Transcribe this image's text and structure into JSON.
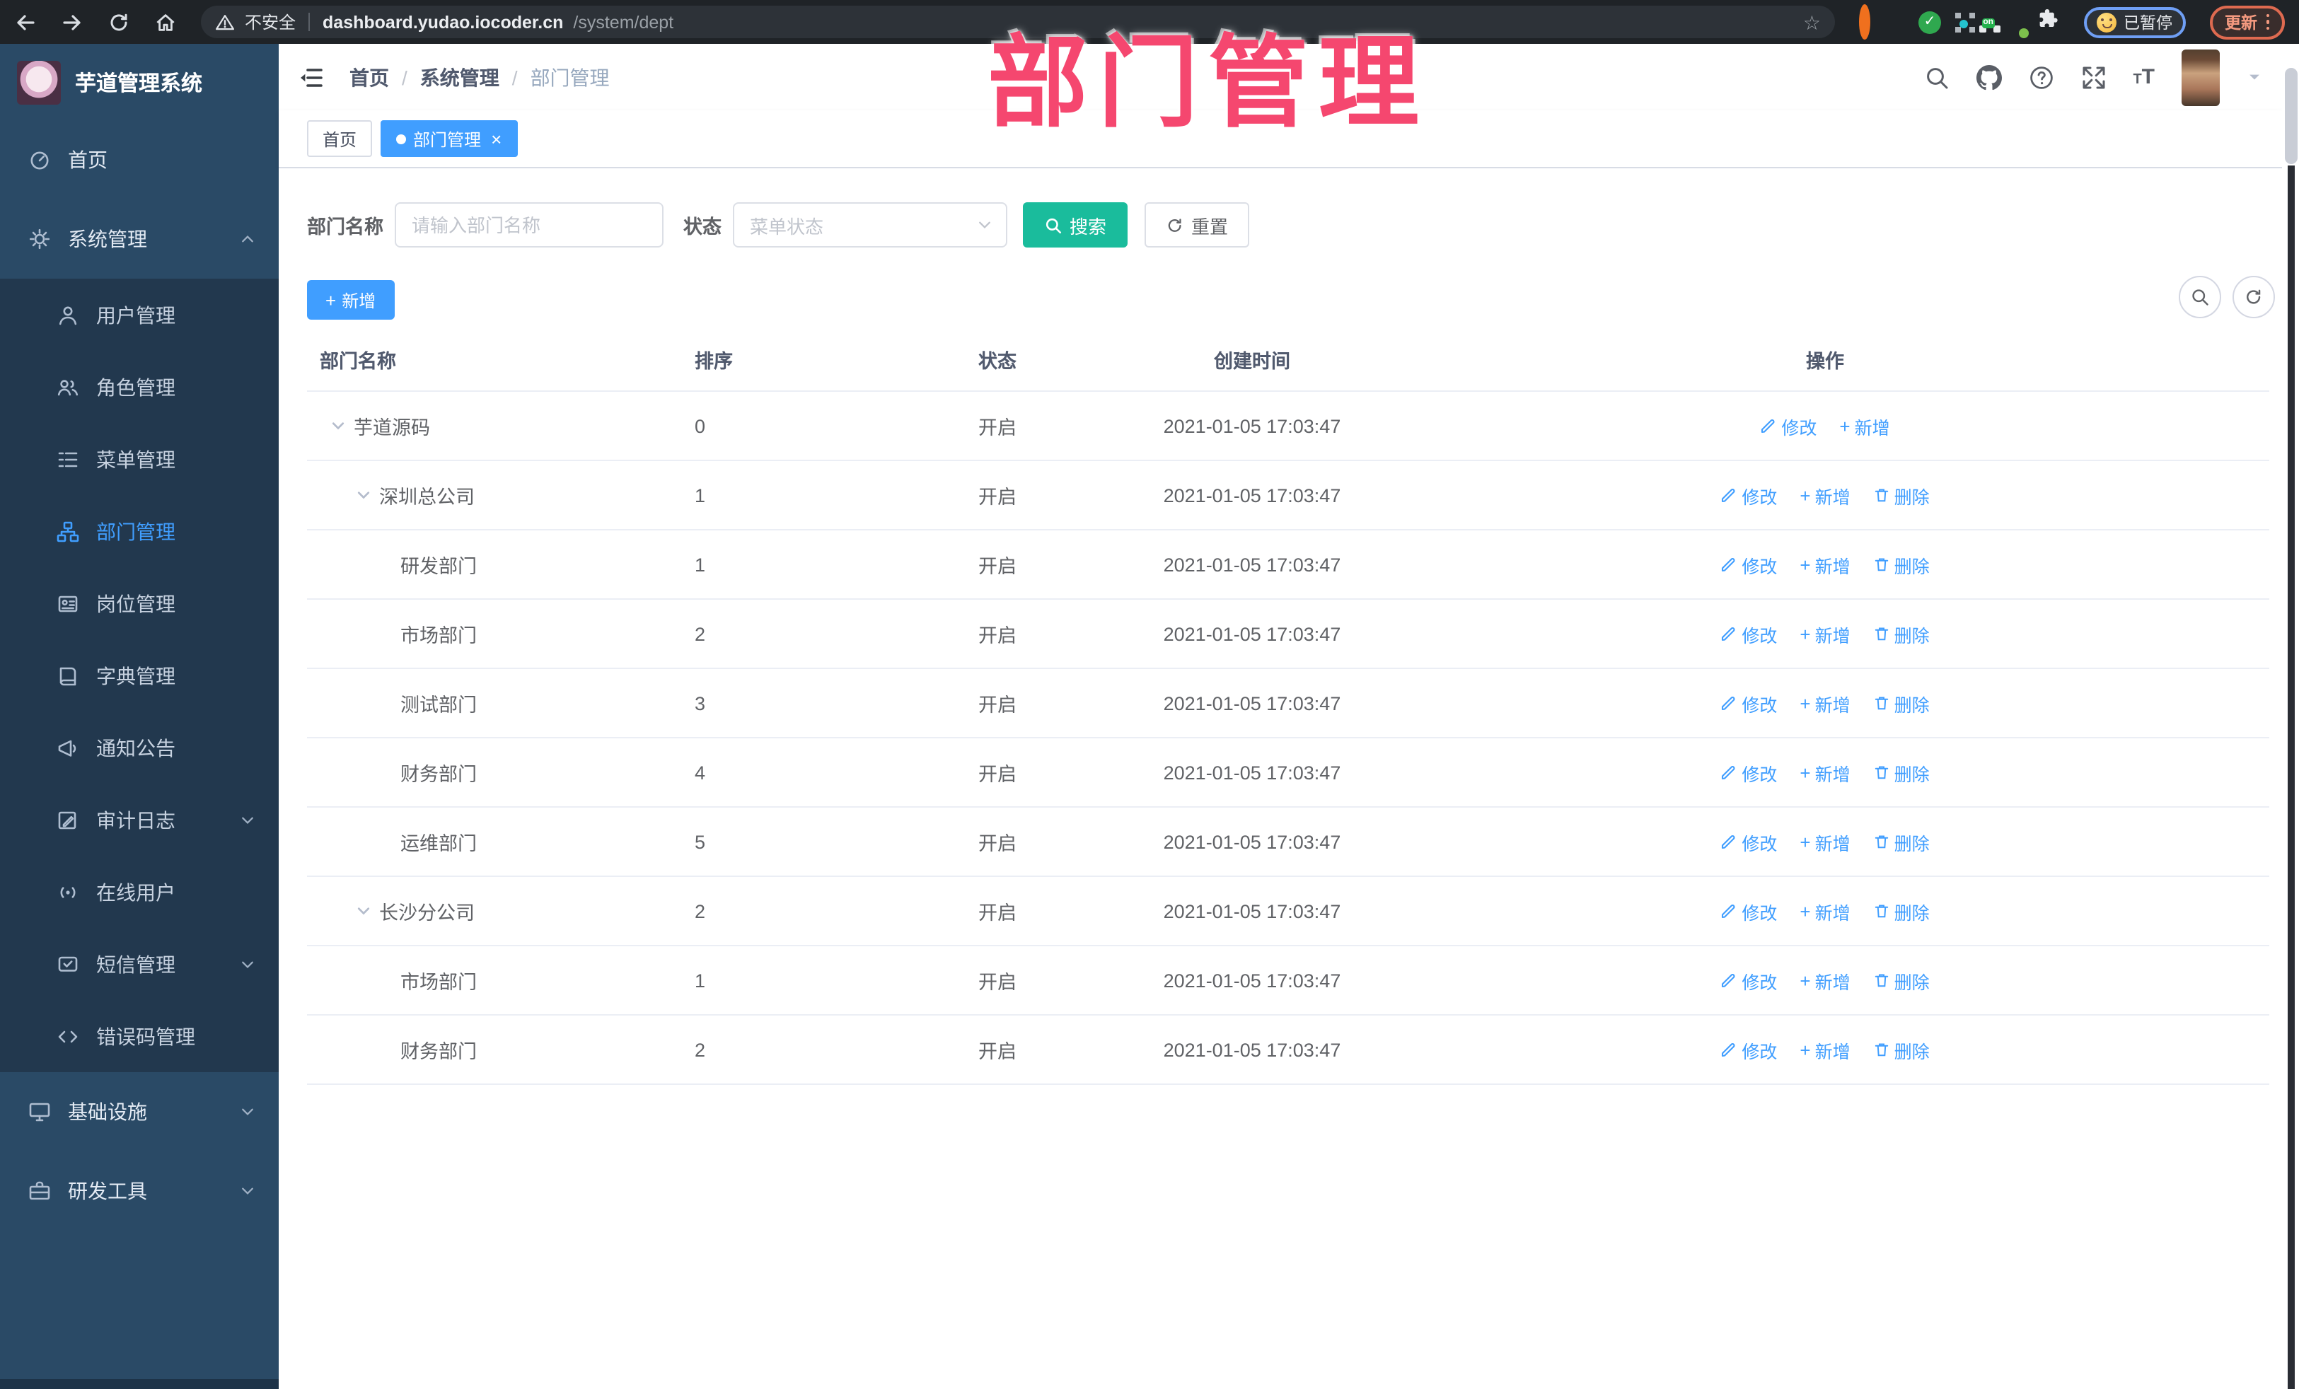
{
  "annotation": {
    "text": "部门管理",
    "color": "#F5476F"
  },
  "browser": {
    "security_label": "不安全",
    "url_host": "dashboard.yudao.iocoder.cn",
    "url_path": "/system/dept",
    "profile_status": "已暂停",
    "update_label": "更新"
  },
  "glyphs": {
    "slash": "/",
    "close": "×",
    "plus": "+",
    "star": "☆",
    "check": "✓"
  },
  "sidebar": {
    "logo_title": "芋道管理系统",
    "items": [
      {
        "label": "首页"
      },
      {
        "label": "系统管理"
      },
      {
        "label": "用户管理"
      },
      {
        "label": "角色管理"
      },
      {
        "label": "菜单管理"
      },
      {
        "label": "部门管理"
      },
      {
        "label": "岗位管理"
      },
      {
        "label": "字典管理"
      },
      {
        "label": "通知公告"
      },
      {
        "label": "审计日志"
      },
      {
        "label": "在线用户"
      },
      {
        "label": "短信管理"
      },
      {
        "label": "错误码管理"
      },
      {
        "label": "基础设施"
      },
      {
        "label": "研发工具"
      }
    ]
  },
  "app_header": {
    "breadcrumb": [
      "首页",
      "系统管理",
      "部门管理"
    ]
  },
  "tabs": [
    {
      "label": "首页"
    },
    {
      "label": "部门管理"
    }
  ],
  "filters": {
    "dept_label": "部门名称",
    "dept_placeholder": "请输入部门名称",
    "status_label": "状态",
    "status_placeholder": "菜单状态",
    "search_label": "搜索",
    "reset_label": "重置"
  },
  "toolbar": {
    "add_label": "新增"
  },
  "table": {
    "columns": [
      "部门名称",
      "排序",
      "状态",
      "创建时间",
      "操作"
    ],
    "action_labels": {
      "edit": "修改",
      "add": "新增",
      "delete": "删除"
    },
    "rows": [
      {
        "name": "芋道源码",
        "sort": "0",
        "status": "开启",
        "time": "2021-01-05 17:03:47"
      },
      {
        "name": "深圳总公司",
        "sort": "1",
        "status": "开启",
        "time": "2021-01-05 17:03:47"
      },
      {
        "name": "研发部门",
        "sort": "1",
        "status": "开启",
        "time": "2021-01-05 17:03:47"
      },
      {
        "name": "市场部门",
        "sort": "2",
        "status": "开启",
        "time": "2021-01-05 17:03:47"
      },
      {
        "name": "测试部门",
        "sort": "3",
        "status": "开启",
        "time": "2021-01-05 17:03:47"
      },
      {
        "name": "财务部门",
        "sort": "4",
        "status": "开启",
        "time": "2021-01-05 17:03:47"
      },
      {
        "name": "运维部门",
        "sort": "5",
        "status": "开启",
        "time": "2021-01-05 17:03:47"
      },
      {
        "name": "长沙分公司",
        "sort": "2",
        "status": "开启",
        "time": "2021-01-05 17:03:47"
      },
      {
        "name": "市场部门",
        "sort": "1",
        "status": "开启",
        "time": "2021-01-05 17:03:47"
      },
      {
        "name": "财务部门",
        "sort": "2",
        "status": "开启",
        "time": "2021-01-05 17:03:47"
      }
    ]
  },
  "colors": {
    "accent": "#409EFF",
    "search_button": "#1ABC9C",
    "sidebar_bg": "#2a4a66",
    "sidebar_submenu_bg": "#22384e"
  }
}
